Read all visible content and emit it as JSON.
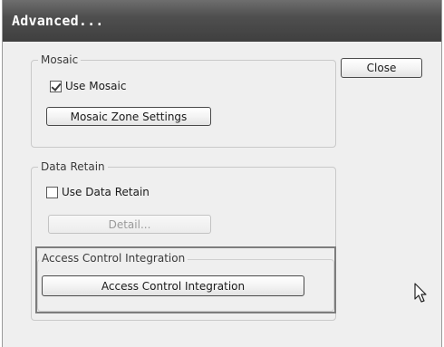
{
  "window": {
    "title": "Advanced..."
  },
  "buttons": {
    "close": "Close"
  },
  "mosaic": {
    "group_label": "Mosaic",
    "use_checkbox_label": "Use Mosaic",
    "use_checked": true,
    "zone_settings_button": "Mosaic Zone Settings"
  },
  "data_retain": {
    "group_label": "Data Retain",
    "use_checkbox_label": "Use Data Retain",
    "use_checked": false,
    "detail_button": "Detail..."
  },
  "access_control": {
    "group_label": "Access Control Integration",
    "button": "Access Control Integration"
  }
}
